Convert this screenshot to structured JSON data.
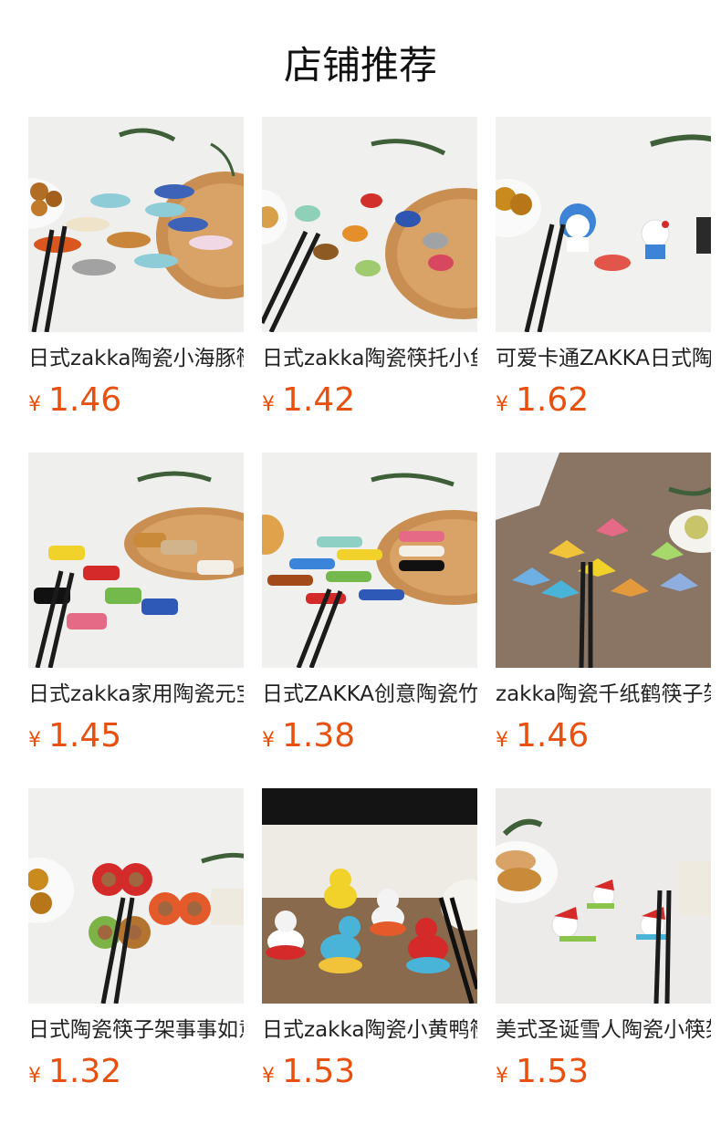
{
  "header": {
    "title": "店铺推荐"
  },
  "products": [
    {
      "name": "日式zakka陶瓷小海豚筷子架",
      "currency": "¥",
      "price": "1.46",
      "image": "ceramic-dolphin-chopstick-rests",
      "bg": "#efefee"
    },
    {
      "name": "日式zakka陶瓷筷托小鱼",
      "currency": "¥",
      "price": "1.42",
      "image": "ceramic-fish-chopstick-rests",
      "bg": "#f0f0ee"
    },
    {
      "name": "可爱卡通ZAKKA日式陶瓷筷架",
      "currency": "¥",
      "price": "1.62",
      "image": "cartoon-cat-chopstick-rests",
      "bg": "#f1f1ef"
    },
    {
      "name": "日式zakka家用陶瓷元宝筷架",
      "currency": "¥",
      "price": "1.45",
      "image": "ceramic-ingot-chopstick-rests",
      "bg": "#efefed"
    },
    {
      "name": "日式ZAKKA创意陶瓷竹节筷架",
      "currency": "¥",
      "price": "1.38",
      "image": "ceramic-bamboo-chopstick-rests",
      "bg": "#f0f0ef"
    },
    {
      "name": "zakka陶瓷千纸鹤筷子架",
      "currency": "¥",
      "price": "1.46",
      "image": "ceramic-crane-chopstick-rests",
      "bg": "#8a7565"
    },
    {
      "name": "日式陶瓷筷子架事事如意",
      "currency": "¥",
      "price": "1.32",
      "image": "ceramic-persimmon-chopstick-rests",
      "bg": "#f0f0ee"
    },
    {
      "name": "日式zakka陶瓷小黄鸭筷架",
      "currency": "¥",
      "price": "1.53",
      "image": "ceramic-duck-chopstick-rests",
      "bg": "#7a5b3f"
    },
    {
      "name": "美式圣诞雪人陶瓷小筷架",
      "currency": "¥",
      "price": "1.53",
      "image": "ceramic-snowman-chopstick-rests",
      "bg": "#ecebea"
    }
  ]
}
